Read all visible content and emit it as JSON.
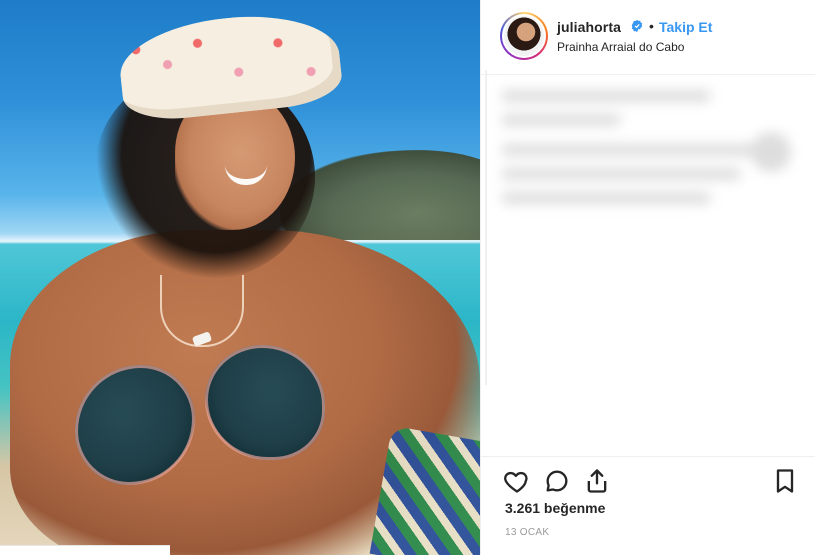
{
  "post": {
    "username": "juliahorta",
    "follow_label": "Takip Et",
    "separator": "•",
    "location": "Prainha Arraial do Cabo",
    "likes_text": "3.261 beğenme",
    "date_text": "13 OCAK"
  },
  "icons": {
    "verified": "verified-icon",
    "like": "heart-icon",
    "comment": "comment-icon",
    "share": "share-icon",
    "save": "bookmark-icon"
  },
  "colors": {
    "accent": "#3897f0",
    "text": "#262626",
    "muted": "#999999",
    "border": "#efefef"
  }
}
